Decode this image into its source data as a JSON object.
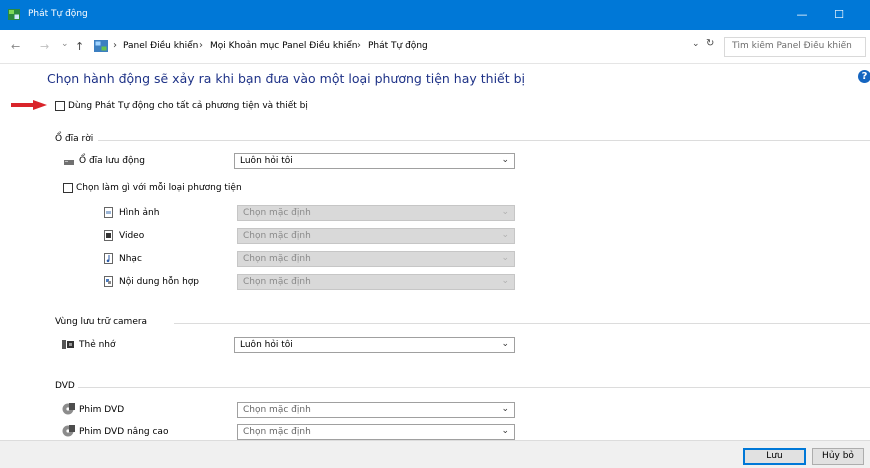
{
  "window": {
    "title": "Phát Tự động",
    "minimize_glyph": "—",
    "maximize_glyph": "☐"
  },
  "address_bar": {
    "back_glyph": "←",
    "forward_glyph": "→",
    "recent_glyph": "⌄",
    "up_glyph": "↑",
    "separator": "›",
    "crumbs": [
      "Panel Điều khiển",
      "Mọi Khoản mục Panel Điều khiển",
      "Phát Tự động"
    ],
    "dropdown_glyph": "⌄",
    "refresh_glyph": "↻",
    "search_placeholder": "Tìm kiếm Panel Điều khiển"
  },
  "main": {
    "heading": "Chọn hành động sẽ xảy ra khi bạn đưa vào một loại phương tiện hay thiết bị",
    "help_glyph": "?",
    "use_autoplay_label": "Dùng Phát Tự động cho tất cả phương tiện và thiết bị",
    "removable": {
      "group_label": "Ổ đĩa rời",
      "drive_label": "Ổ đĩa lưu động",
      "drive_value": "Luôn hỏi tôi",
      "choose_each_label": "Chọn làm gì với mỗi loại phương tiện",
      "media": [
        {
          "label": "Hình ảnh",
          "value": "Chọn mặc định",
          "icon": "picture-file-icon"
        },
        {
          "label": "Video",
          "value": "Chọn mặc định",
          "icon": "video-file-icon"
        },
        {
          "label": "Nhạc",
          "value": "Chọn mặc định",
          "icon": "music-file-icon"
        },
        {
          "label": "Nội dung hỗn hợp",
          "value": "Chọn mặc định",
          "icon": "mixed-content-icon"
        }
      ]
    },
    "camera": {
      "group_label": "Vùng lưu trữ camera",
      "memory_card_label": "Thẻ nhớ",
      "memory_card_value": "Luôn hỏi tôi"
    },
    "dvd": {
      "group_label": "DVD",
      "items": [
        {
          "label": "Phim DVD",
          "value": "Chọn mặc định"
        },
        {
          "label": "Phim DVD nâng cao",
          "value": "Chọn mặc định"
        }
      ]
    }
  },
  "footer": {
    "save_label": "Lưu",
    "cancel_label": "Hủy bỏ"
  },
  "chevron_glyph": "⌄",
  "colors": {
    "titlebar": "#0078d7",
    "heading": "#1e3287",
    "arrow": "#d9242a",
    "disabled_select": "#d9d9d9"
  }
}
